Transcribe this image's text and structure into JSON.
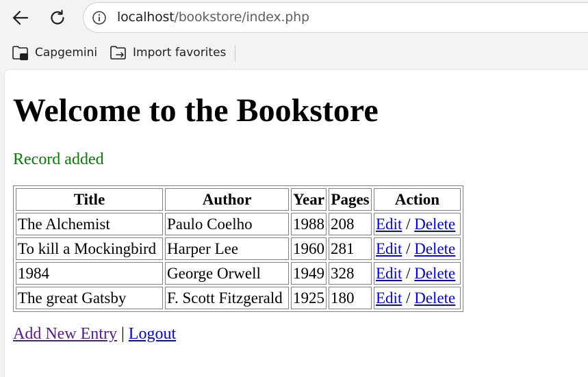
{
  "browser": {
    "url_host": "localhost",
    "url_path": "/bookstore/index.php",
    "favorites": [
      {
        "label": "Capgemini"
      },
      {
        "label": "Import favorites"
      }
    ]
  },
  "page": {
    "title": "Welcome to the Bookstore",
    "status_message": "Record added",
    "table": {
      "headers": [
        "Title",
        "Author",
        "Year",
        "Pages",
        "Action"
      ],
      "rows": [
        {
          "title": "The Alchemist",
          "author": "Paulo Coelho",
          "year": "1988",
          "pages": "208"
        },
        {
          "title": "To kill a Mockingbird",
          "author": "Harper Lee",
          "year": "1960",
          "pages": "281"
        },
        {
          "title": "1984",
          "author": "George Orwell",
          "year": "1949",
          "pages": "328"
        },
        {
          "title": "The great Gatsby",
          "author": "F. Scott Fitzgerald",
          "year": "1925",
          "pages": "180"
        }
      ],
      "action_edit": "Edit",
      "action_separator": "/",
      "action_delete": "Delete"
    },
    "footer": {
      "add_link": "Add New Entry",
      "separator": "|",
      "logout_link": "Logout"
    }
  },
  "colors": {
    "status": "#008000",
    "link": "#0000ee",
    "visited_link": "#551a8b"
  }
}
